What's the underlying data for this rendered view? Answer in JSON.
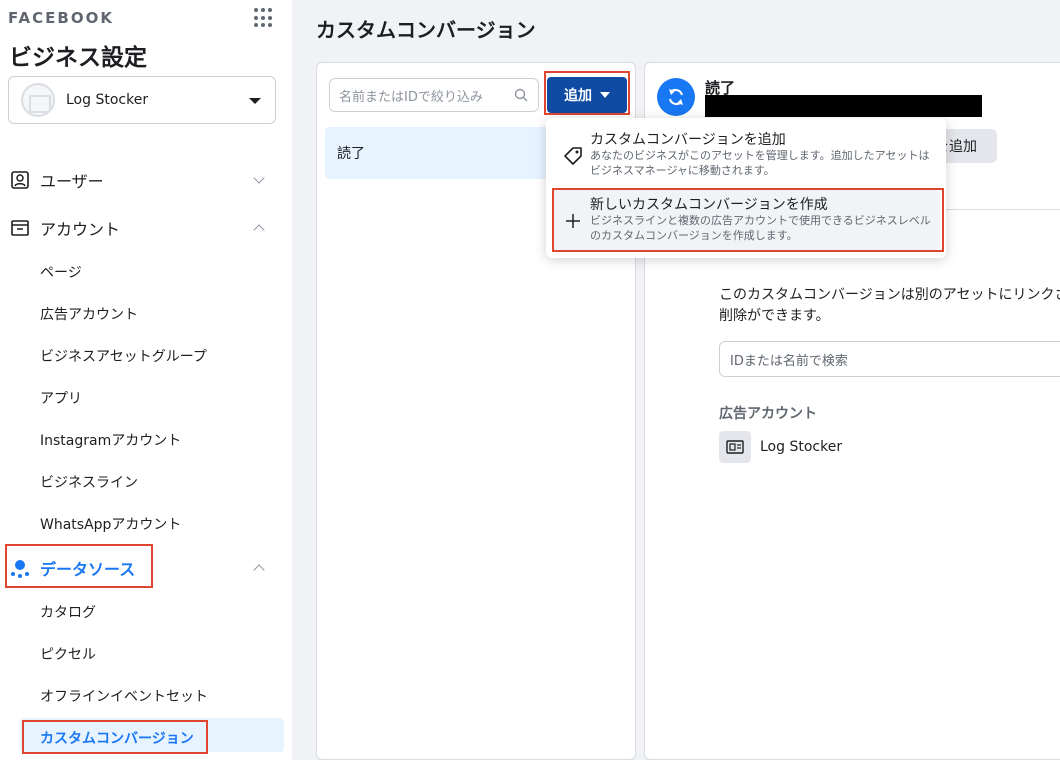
{
  "sidebar": {
    "brand": "FACEBOOK",
    "title": "ビジネス設定",
    "account": "Log Stocker",
    "sections": {
      "users": "ユーザー",
      "accounts": "アカウント",
      "data_sources": "データソース"
    },
    "account_items": [
      "ページ",
      "広告アカウント",
      "ビジネスアセットグループ",
      "アプリ",
      "Instagramアカウント",
      "ビジネスライン",
      "WhatsAppアカウント"
    ],
    "data_source_items": [
      "カタログ",
      "ピクセル",
      "オフラインイベントセット",
      "カスタムコンバージョン"
    ]
  },
  "main": {
    "title": "カスタムコンバージョン",
    "search_placeholder": "名前またはIDで絞り込み",
    "add_label": "追加",
    "list": [
      "読了"
    ]
  },
  "detail": {
    "title": "読了",
    "partial_button": "を追加",
    "description": "このカスタムコンバージョンは別のアセットにリンクさ削除ができます。",
    "search_placeholder": "IDまたは名前で検索",
    "section_label": "広告アカウント",
    "asset_name": "Log Stocker"
  },
  "menu": {
    "items": [
      {
        "title": "カスタムコンバージョンを追加",
        "desc": "あなたのビジネスがこのアセットを管理します。追加したアセットはビジネスマネージャに移動されます。"
      },
      {
        "title": "新しいカスタムコンバージョンを作成",
        "desc": "ビジネスラインと複数の広告アカウントで使用できるビジネスレベルのカスタムコンバージョンを作成します。"
      }
    ]
  },
  "colors": {
    "accent": "#1877f2",
    "button": "#0f4ba3",
    "highlight_box": "#e0452f",
    "selected_bg": "#e7f3ff"
  }
}
